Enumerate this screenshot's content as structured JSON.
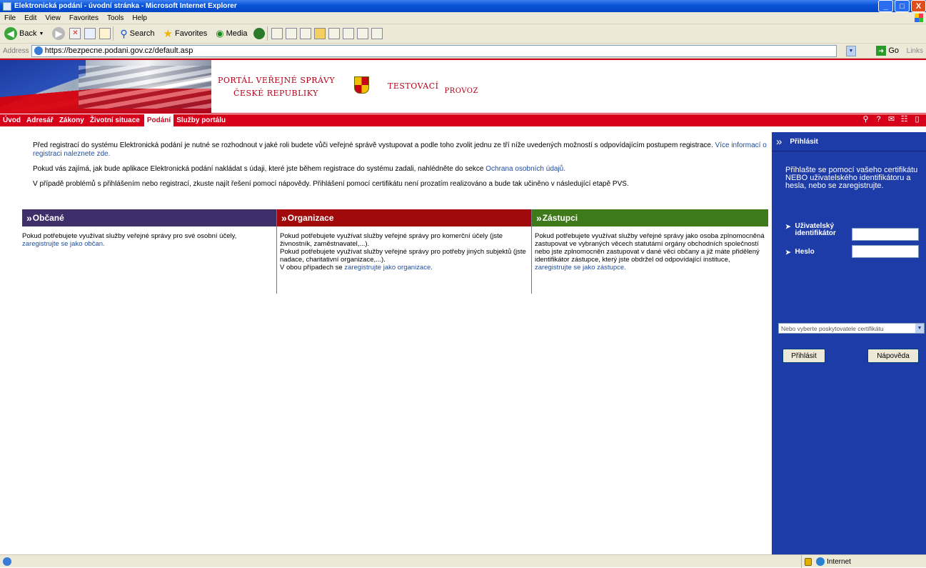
{
  "window": {
    "title": "Elektronická podání - úvodní stránka - Microsoft Internet Explorer",
    "buttons": {
      "minimize": "_",
      "maximize": "□",
      "close": "X"
    }
  },
  "menubar": [
    "File",
    "Edit",
    "View",
    "Favorites",
    "Tools",
    "Help"
  ],
  "toolbar": {
    "back": "Back",
    "search": "Search",
    "favorites": "Favorites",
    "media": "Media"
  },
  "address": {
    "label": "Address",
    "url": "https://bezpecne.podani.gov.cz/default.asp",
    "go": "Go",
    "links": "Links"
  },
  "header": {
    "portal_line1": "PORTÁL VEŘEJNÉ SPRÁVY",
    "portal_line2": "ČESKÉ REPUBLIKY",
    "test_line1": "TESTOVACÍ",
    "test_line2": "PROVOZ"
  },
  "nav": {
    "items": [
      "Úvod",
      "Adresář",
      "Zákony",
      "Životní situace",
      "Podání",
      "Služby portálu"
    ],
    "active": "Podání"
  },
  "intro": {
    "p1_text": "Před registrací do systému Elektronická podání je nutné se rozhodnout v jaké roli budete vůči veřejné správě vystupovat a podle toho zvolit jednu ze tří níže uvedených možností s odpovídajícím postupem registrace.",
    "p1_link": "Více informací o registraci naleznete zde.",
    "p2_text": "Pokud vás zajímá, jak bude aplikace Elektronická podání nakládat s údaji, které jste během registrace do systému zadali, nahlédněte do sekce",
    "p2_link": "Ochrana osobních údajů.",
    "p3_text": "V případě problémů s přihlášením nebo registrací, zkuste najít řešení pomocí nápovědy. Přihlášení pomocí certifikátu není prozatím realizováno a bude tak učiněno v následující etapě PVS."
  },
  "boxes": {
    "obcane": {
      "title": "Občané",
      "text": "Pokud potřebujete využívat služby veřejné správy pro své osobní účely,",
      "link": "zaregistrujte se jako občan."
    },
    "organizace": {
      "title": "Organizace",
      "text1": "Pokud potřebujete využívat služby veřejné správy pro komerční účely (jste živnostník, zaměstnavatel,...).",
      "text2": "Pokud potřebujete využívat služby veřejné správy pro potřeby jiných subjektů (jste nadace, charitativní organizace,...).",
      "text3": "V obou případech se",
      "link": "zaregistrujte jako organizace."
    },
    "zastupci": {
      "title": "Zástupci",
      "text": "Pokud potřebujete využívat služby veřejné správy jako osoba zplnomocněná zastupovat ve vybraných věcech statutární orgány obchodních společností nebo jste zplnomocněn zastupovat v dané věci občany a již máte přidělený identifikátor zástupce, který jste obdržel od odpovídající instituce,",
      "link": "zaregistrujte se jako zástupce."
    }
  },
  "login": {
    "title": "Přihlásit",
    "info": "Přihlašte se pomocí vašeho certifikátu NEBO uživatelského identifikátoru a hesla, nebo se zaregistrujte.",
    "user_label_1": "Uživatelský",
    "user_label_2": "identifikátor",
    "user_value": "",
    "pass_label": "Heslo",
    "pass_value": "",
    "cert_select": "Nebo vyberte poskytovatele certifikátu",
    "login_button": "Přihlásit",
    "help_button": "Nápověda"
  },
  "status": {
    "zone": "Internet"
  }
}
